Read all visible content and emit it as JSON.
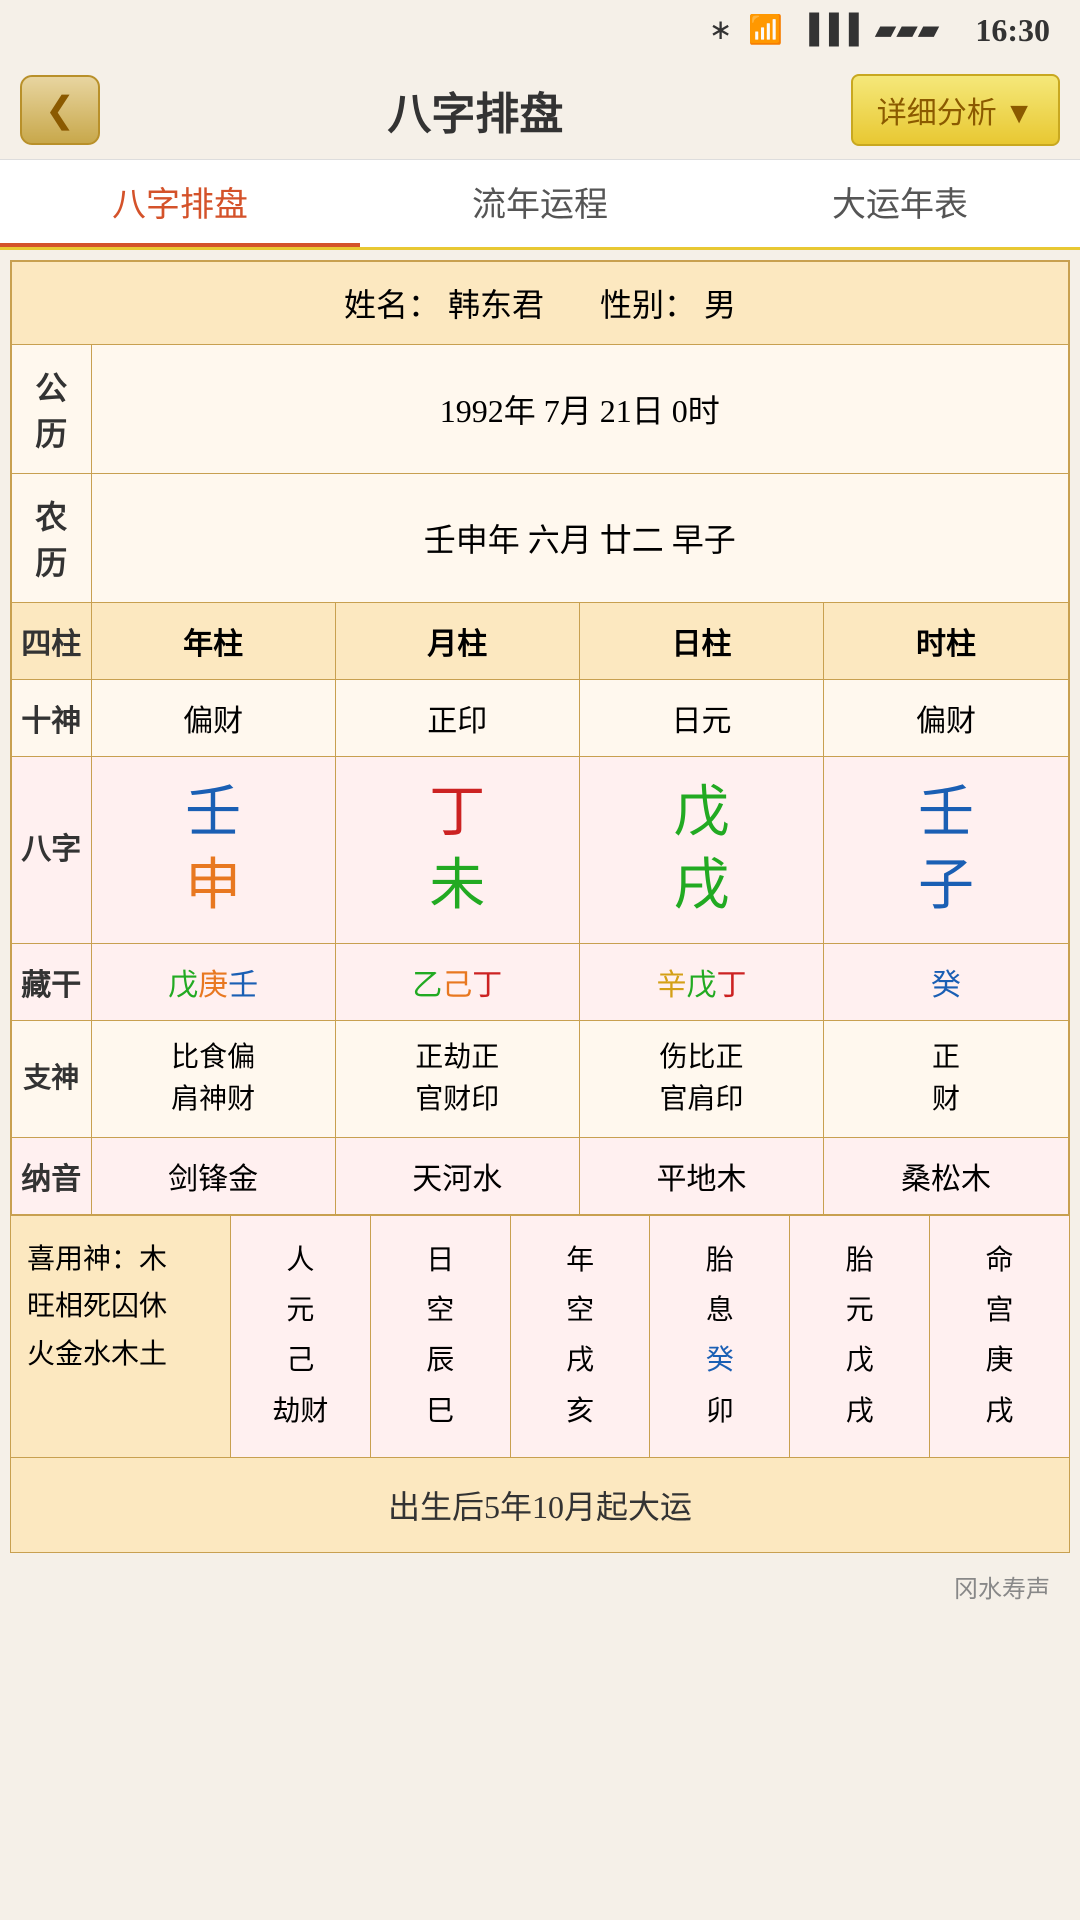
{
  "statusBar": {
    "time": "16:30",
    "icons": "bluetooth wifi signal battery"
  },
  "header": {
    "backLabel": "‹",
    "title": "八字排盘",
    "detailBtn": "详细分析 ▼"
  },
  "tabs": [
    {
      "id": "bazi",
      "label": "八字排盘",
      "active": true
    },
    {
      "id": "liuyun",
      "label": "流年运程",
      "active": false
    },
    {
      "id": "dayun",
      "label": "大运年表",
      "active": false
    }
  ],
  "infoRow": {
    "name_label": "姓名：",
    "name": "韩东君",
    "gender_label": "性别：",
    "gender": "男"
  },
  "gongli": {
    "label": "公历",
    "value": "1992年 7月 21日 0时"
  },
  "nongli": {
    "label": "农历",
    "value": "壬申年 六月 廿二 早子"
  },
  "sizhu": {
    "label": "四柱",
    "cols": [
      "年柱",
      "月柱",
      "日柱",
      "时柱"
    ]
  },
  "shishen": {
    "label": "十神",
    "cols": [
      "偏财",
      "正印",
      "日元",
      "偏财"
    ]
  },
  "bazi": {
    "label": "八字",
    "cols": [
      {
        "tian": "壬",
        "tianColor": "blue",
        "di": "申",
        "diColor": "orange"
      },
      {
        "tian": "丁",
        "tianColor": "red",
        "di": "未",
        "diColor": "green"
      },
      {
        "tian": "戊",
        "tianColor": "green",
        "di": "戌",
        "diColor": "green"
      },
      {
        "tian": "壬",
        "tianColor": "blue",
        "di": "子",
        "diColor": "blue"
      }
    ]
  },
  "zanggan": {
    "label": "藏干",
    "cols": [
      {
        "text": "戊庚壬",
        "colors": [
          "green",
          "orange",
          "blue"
        ]
      },
      {
        "text": "乙己丁",
        "colors": [
          "green",
          "orange",
          "red"
        ]
      },
      {
        "text": "辛戊丁",
        "colors": [
          "gold",
          "green",
          "red"
        ]
      },
      {
        "text": "癸",
        "colors": [
          "blue"
        ]
      }
    ]
  },
  "zhishen": {
    "label": "支神",
    "cols": [
      "比食偏\n肩神财",
      "正劫正\n官财印",
      "伤比正\n官肩印",
      "正\n财"
    ]
  },
  "nayin": {
    "label": "纳音",
    "cols": [
      "剑锋金",
      "天河水",
      "平地木",
      "桑松木"
    ]
  },
  "bottomLeft": {
    "line1": "喜用神：木",
    "line2": "旺相死囚休",
    "line3": "火金水木土"
  },
  "bottomCols": [
    {
      "lines": [
        "人",
        "元",
        "己",
        "劫财"
      ]
    },
    {
      "lines": [
        "日",
        "空",
        "辰",
        "巳"
      ]
    },
    {
      "lines": [
        "年",
        "空",
        "戌",
        "亥"
      ]
    },
    {
      "lines": [
        "胎",
        "息",
        "癸",
        "卯"
      ]
    },
    {
      "lines": [
        "胎",
        "元",
        "戊",
        "戌"
      ]
    },
    {
      "lines": [
        "命",
        "宫",
        "庚",
        "戌"
      ]
    }
  ],
  "footer": "出生后5年10月起大运",
  "watermark": "冈水寿声"
}
